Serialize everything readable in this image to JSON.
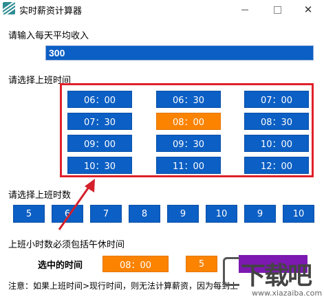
{
  "window": {
    "title": "实时薪资计算器",
    "min_glyph": "",
    "close_glyph": "✕"
  },
  "income": {
    "label": "请输入每天平均收入",
    "value": "300"
  },
  "start_time": {
    "label": "请选择上班时间",
    "options": [
      "06：00",
      "06：30",
      "07：00",
      "07：30",
      "08：00",
      "08：30",
      "09：00",
      "09：30",
      "10：00",
      "10：30",
      "11：00",
      "12：00"
    ],
    "selected": "08：00"
  },
  "work_hours": {
    "label": "请选择上班时数",
    "options": [
      "5",
      "6",
      "7",
      "8",
      "9",
      "10",
      "9",
      "10"
    ],
    "note": "上班小时数必须包括午休时间"
  },
  "selection": {
    "label": "选中的时间",
    "time": "08：00",
    "hours": "5"
  },
  "footer": {
    "text": "注意：如果上班时间>现行时间，则无法计算薪资，因为每到上"
  },
  "watermark": {
    "main": "下载吧",
    "sub": "www.xiazaiba.com"
  },
  "colors": {
    "button_blue": "#0c5fc4",
    "selected_orange": "#fb8300",
    "highlight_red": "#e0202a",
    "action_purple": "#7c19b0"
  }
}
